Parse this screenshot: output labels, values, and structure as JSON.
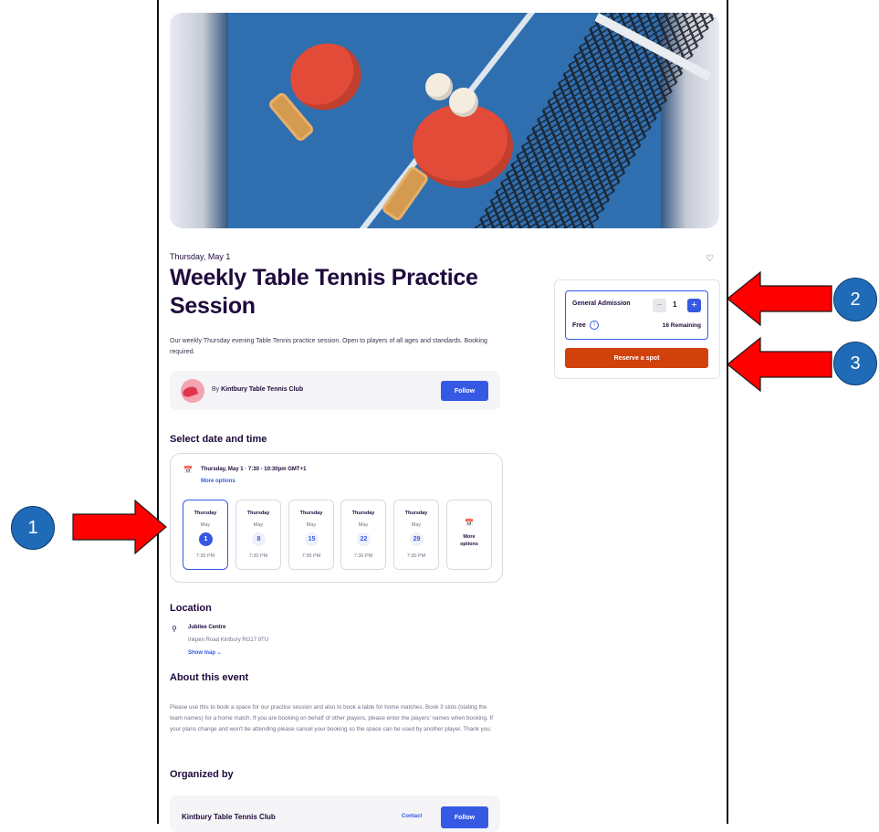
{
  "event": {
    "date_label": "Thursday, May 1",
    "title": "Weekly Table Tennis Practice Session",
    "description": "Our weekly Thursday evening Table Tennis practice session. Open to players of all ages and standards. Booking required."
  },
  "organizer_card": {
    "by_prefix": "By",
    "name": "Kintbury Table Tennis Club",
    "follow_label": "Follow"
  },
  "date_time": {
    "section_title": "Select date and time",
    "selected_line": "Thursday, May 1 · 7:30 - 10:30pm GMT+1",
    "more_options_link": "More options",
    "tiles": [
      {
        "day": "Thursday",
        "month": "May",
        "num": "1",
        "time": "7:30 PM",
        "selected": true
      },
      {
        "day": "Thursday",
        "month": "May",
        "num": "8",
        "time": "7:30 PM",
        "selected": false
      },
      {
        "day": "Thursday",
        "month": "May",
        "num": "15",
        "time": "7:30 PM",
        "selected": false
      },
      {
        "day": "Thursday",
        "month": "May",
        "num": "22",
        "time": "7:30 PM",
        "selected": false
      },
      {
        "day": "Thursday",
        "month": "May",
        "num": "29",
        "time": "7:30 PM",
        "selected": false
      }
    ],
    "more_tile_label": "More options"
  },
  "location": {
    "section_title": "Location",
    "venue": "Jubilee Centre",
    "address": "Inkpen Road Kintbury RG17 9TU",
    "show_map": "Show map ⌄"
  },
  "about": {
    "section_title": "About this event",
    "text": "Please use this to book a space for our practice session and also to book a table for home matches. Book 3 slots (stating the team names) for a home match. If you are booking on behalf of other players, please enter the players' names when booking. If your plans change and won't be attending please cancel your booking so the space can be used by another player. Thank you."
  },
  "organized_by": {
    "section_title": "Organized by",
    "name": "Kintbury Table Tennis Club",
    "contact_label": "Contact",
    "follow_label": "Follow"
  },
  "ticket": {
    "name": "General Admission",
    "price": "Free",
    "quantity": "1",
    "remaining": "16 Remaining",
    "minus": "−",
    "plus": "+",
    "info": "i",
    "reserve_label": "Reserve a spot"
  },
  "icons": {
    "heart": "♡",
    "calendar": "📅",
    "pin": "⚲"
  },
  "callouts": [
    "1",
    "2",
    "3"
  ],
  "colors": {
    "accent": "#3659e3",
    "reserve": "#d1410c",
    "callout_arrow": "#ff0000",
    "callout_circle": "#1f6bb8"
  }
}
